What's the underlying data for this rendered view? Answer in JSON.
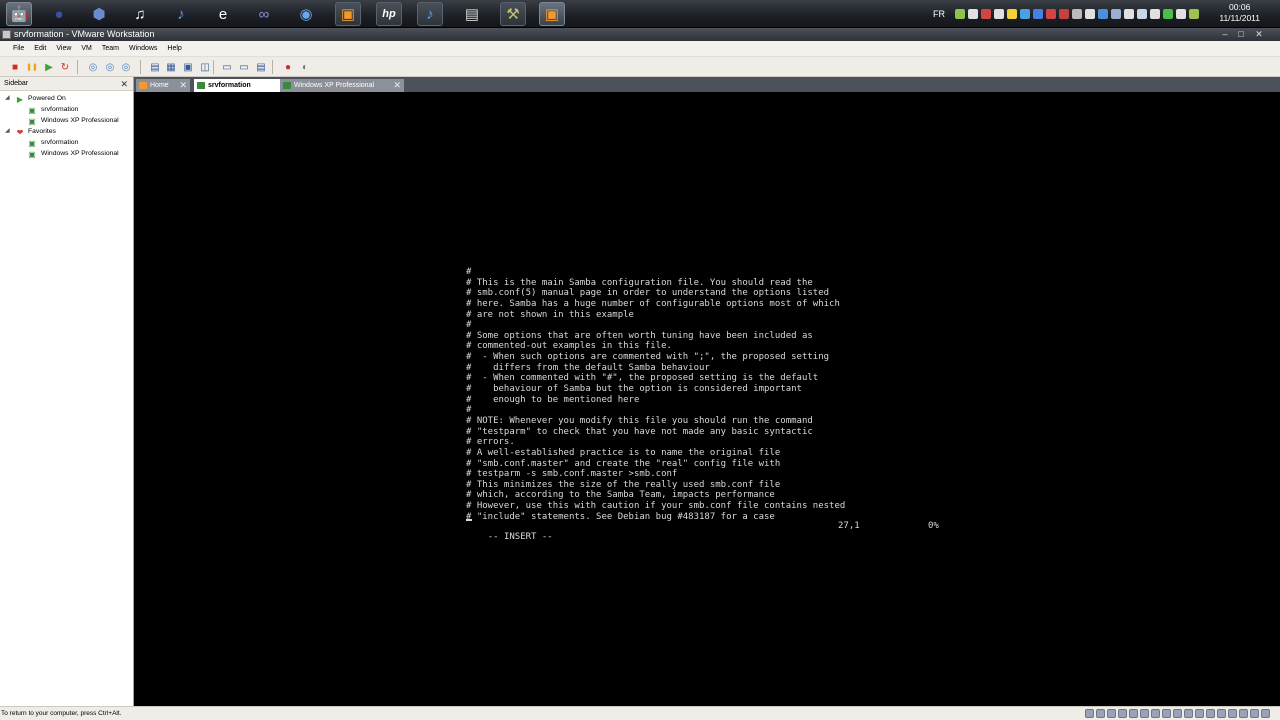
{
  "taskbar": {
    "icons": [
      {
        "name": "android-icon",
        "glyph": "🤖",
        "color": "#8bbf3b",
        "state": "active"
      },
      {
        "name": "eclipse-icon",
        "glyph": "●",
        "color": "#3b4fa8",
        "state": ""
      },
      {
        "name": "virtualbox-icon",
        "glyph": "⬢",
        "color": "#6a8ccf",
        "state": ""
      },
      {
        "name": "music-note-icon",
        "glyph": "♫",
        "color": "#ffffff",
        "state": ""
      },
      {
        "name": "itunes-icon",
        "glyph": "♪",
        "color": "#5aa0e8",
        "state": ""
      },
      {
        "name": "internet-explorer-icon",
        "glyph": "e",
        "color": "#ffffff",
        "state": ""
      },
      {
        "name": "infinity-icon",
        "glyph": "∞",
        "color": "#8a8fd8",
        "state": ""
      },
      {
        "name": "globe-icon",
        "glyph": "◉",
        "color": "#6aa6e8",
        "state": ""
      },
      {
        "name": "vmware-icon",
        "glyph": "▣",
        "color": "#f39a2b",
        "state": "running"
      },
      {
        "name": "hp-icon",
        "glyph": "hp",
        "color": "#ffffff",
        "state": "running"
      },
      {
        "name": "itunes-alt-icon",
        "glyph": "♪",
        "color": "#5aa0e8",
        "state": "running"
      },
      {
        "name": "folder-icon",
        "glyph": "▤",
        "color": "#d8d8d8",
        "state": ""
      },
      {
        "name": "tool-icon",
        "glyph": "⚒",
        "color": "#c0c070",
        "state": "running"
      },
      {
        "name": "vmware-workstation-icon",
        "glyph": "▣",
        "color": "#f39a2b",
        "state": "active"
      }
    ],
    "language": "FR",
    "clock_time": "00:06",
    "clock_date": "11/11/2011",
    "tray_colors": [
      "#8fc24a",
      "#e0e0e0",
      "#d24545",
      "#e0e0e0",
      "#f2d23b",
      "#4aa0e0",
      "#4a7ee0",
      "#d24545",
      "#c94040",
      "#bbbbbb",
      "#e0e0e0",
      "#4a90e0",
      "#9ab0d0",
      "#e0e0e0",
      "#c9d6e8",
      "#e0e0e0",
      "#4ac04a",
      "#e0e0e0",
      "#a0c050"
    ]
  },
  "window": {
    "title": "srvformation - VMware Workstation",
    "minimize": "–",
    "maximize": "□",
    "close": "✕"
  },
  "menu": [
    "File",
    "Edit",
    "View",
    "VM",
    "Team",
    "Windows",
    "Help"
  ],
  "toolbar": {
    "icons": [
      {
        "name": "power-off-icon",
        "glyph": "■",
        "color": "#d62a1e"
      },
      {
        "name": "suspend-icon",
        "glyph": "❚❚",
        "color": "#e8a317"
      },
      {
        "name": "power-on-icon",
        "glyph": "▶",
        "color": "#3aa52f"
      },
      {
        "name": "reset-icon",
        "glyph": "↻",
        "color": "#d62a1e"
      },
      {
        "name": "snapshot-icon",
        "glyph": "◎",
        "color": "#4a7fbf"
      },
      {
        "name": "revert-snapshot-icon",
        "glyph": "◎",
        "color": "#4a7fbf"
      },
      {
        "name": "snapshot-manager-icon",
        "glyph": "◎",
        "color": "#4a7fbf"
      },
      {
        "name": "show-sidebar-icon",
        "glyph": "▤",
        "color": "#34589a"
      },
      {
        "name": "quick-switch-icon",
        "glyph": "▦",
        "color": "#34589a"
      },
      {
        "name": "full-screen-icon",
        "glyph": "▣",
        "color": "#34589a"
      },
      {
        "name": "unity-icon",
        "glyph": "◫",
        "color": "#34589a"
      },
      {
        "name": "console-view-icon",
        "glyph": "▭",
        "color": "#34589a"
      },
      {
        "name": "thumbnail-view-icon",
        "glyph": "▭",
        "color": "#34589a"
      },
      {
        "name": "summary-view-icon",
        "glyph": "▤",
        "color": "#34589a"
      },
      {
        "name": "record-icon",
        "glyph": "●",
        "color": "#c92a2a"
      },
      {
        "name": "replay-icon",
        "glyph": "◐",
        "color": "#777777"
      }
    ]
  },
  "sidebar": {
    "title": "Sidebar",
    "close": "✕",
    "tree": [
      {
        "name": "tree-powered-on",
        "label": "Powered On",
        "level": 0,
        "toggle": "◢",
        "glyph": "▶",
        "color": "#3aa52f"
      },
      {
        "name": "tree-srvformation-1",
        "label": "srvformation",
        "level": 1,
        "toggle": "",
        "glyph": "▣",
        "color": "#3b8a3b"
      },
      {
        "name": "tree-winxp-1",
        "label": "Windows XP Professional",
        "level": 1,
        "toggle": "",
        "glyph": "▣",
        "color": "#3b8a3b"
      },
      {
        "name": "tree-favorites",
        "label": "Favorites",
        "level": 0,
        "toggle": "◢",
        "glyph": "❤",
        "color": "#d23c3c"
      },
      {
        "name": "tree-srvformation-2",
        "label": "srvformation",
        "level": 1,
        "toggle": "",
        "glyph": "▣",
        "color": "#3b8a3b"
      },
      {
        "name": "tree-winxp-2",
        "label": "Windows XP Professional",
        "level": 1,
        "toggle": "",
        "glyph": "▣",
        "color": "#3b8a3b"
      }
    ]
  },
  "tabs": [
    {
      "name": "tab-home",
      "label": "Home",
      "state": "inactive",
      "icon_color": "#f39a2b"
    },
    {
      "name": "tab-srvformation",
      "label": "srvformation",
      "state": "active",
      "icon_color": "#3b8a3b"
    },
    {
      "name": "tab-windows-xp",
      "label": "Windows XP Professional",
      "state": "inactive",
      "icon_color": "#3b8a3b"
    }
  ],
  "tab_close": "✕",
  "terminal": {
    "lines": [
      "#",
      "# This is the main Samba configuration file. You should read the",
      "# smb.conf(5) manual page in order to understand the options listed",
      "# here. Samba has a huge number of configurable options most of which",
      "# are not shown in this example",
      "#",
      "# Some options that are often worth tuning have been included as",
      "# commented-out examples in this file.",
      "#  - When such options are commented with \";\", the proposed setting",
      "#    differs from the default Samba behaviour",
      "#  - When commented with \"#\", the proposed setting is the default",
      "#    behaviour of Samba but the option is considered important",
      "#    enough to be mentioned here",
      "#",
      "# NOTE: Whenever you modify this file you should run the command",
      "# \"testparm\" to check that you have not made any basic syntactic",
      "# errors.",
      "# A well-established practice is to name the original file",
      "# \"smb.conf.master\" and create the \"real\" config file with",
      "# testparm -s smb.conf.master >smb.conf",
      "# This minimizes the size of the really used smb.conf file",
      "# which, according to the Samba Team, impacts performance",
      "# However, use this with caution if your smb.conf file contains nested",
      "# \"include\" statements. See Debian bug #483187 for a case"
    ],
    "mode": "-- INSERT --",
    "position": "27,1",
    "percent": "0%"
  },
  "status": {
    "text": "To return to your computer, press Ctrl+Alt."
  }
}
